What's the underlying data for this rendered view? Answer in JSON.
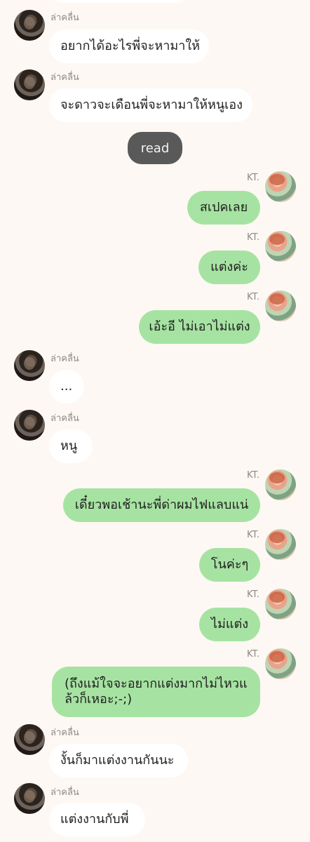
{
  "contacts": {
    "left_name": "ล่าคลื่น",
    "right_name": "KT."
  },
  "status": {
    "read_label": "read"
  },
  "messages": [
    {
      "side": "left",
      "text": "อยากได้อะไรพี่จะหามาให้"
    },
    {
      "side": "left",
      "text": "จะดาวจะเดือนพี่จะหามาให้หนูเอง"
    },
    {
      "side": "right",
      "text": "สเปคเลย"
    },
    {
      "side": "right",
      "text": "แต่งค่ะ"
    },
    {
      "side": "right",
      "text": "เอ้ะอี ไม่เอาไม่แต่ง"
    },
    {
      "side": "left",
      "text": "..."
    },
    {
      "side": "left",
      "text": "หนู"
    },
    {
      "side": "right",
      "text": "เดี๋ยวพอเช้านะพี่ด่าผมไฟแลบแน่"
    },
    {
      "side": "right",
      "text": "โนค่ะๆ"
    },
    {
      "side": "right",
      "text": "ไม่แต่ง"
    },
    {
      "side": "right",
      "text": "(ถึงแม้ใจจะอยากแต่งมากไม่ไหวแล้วก็เหอะ;-;)"
    },
    {
      "side": "left",
      "text": "งั้นก็มาแต่งงานกันนะ"
    },
    {
      "side": "left",
      "text": "แต่งงานกับพี่"
    }
  ],
  "colors": {
    "background": "#fdf8f3",
    "sent_bubble": "#a6e3a2",
    "received_bubble": "#ffffff",
    "read_pill": "#595959"
  }
}
